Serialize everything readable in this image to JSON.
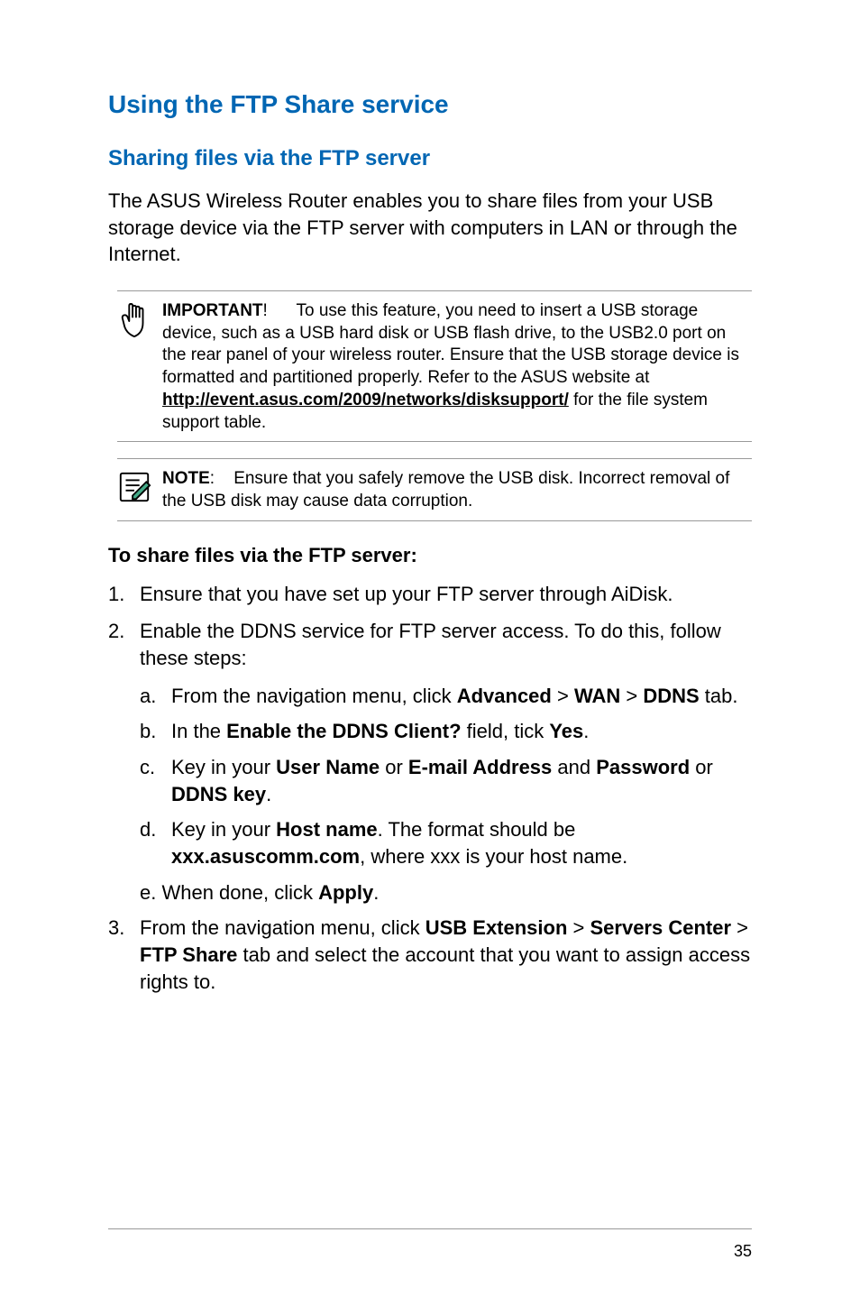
{
  "heading1": "Using the FTP Share service",
  "heading2": "Sharing files via the FTP server",
  "intro": "The ASUS Wireless Router enables you to share files from your USB storage device via the FTP server with computers in LAN or through the Internet.",
  "important": {
    "label": "IMPORTANT",
    "excl": "!",
    "text1": "To use this feature, you need to insert a USB storage device, such as a USB hard disk or USB  flash drive, to the USB2.0 port on the rear panel of your wireless router. Ensure that the USB storage device is formatted and partitioned properly. Refer to the ASUS website at",
    "link": "http://event.asus.com/2009/networks/disksupport/",
    "text2": " for the file system support table."
  },
  "note": {
    "label": "NOTE",
    "colon": ":",
    "text": "Ensure that you safely remove the USB disk. Incorrect removal of the USB disk may cause data corruption."
  },
  "heading3": "To share files via the FTP server:",
  "step1": {
    "num": "1.",
    "text": "Ensure that you have set up your FTP server through AiDisk."
  },
  "step2": {
    "num": "2.",
    "text": "Enable the DDNS service for FTP server access. To do this, follow these steps:",
    "a": {
      "letter": "a.",
      "pre": "From the navigation menu, click ",
      "b1": "Advanced",
      "gt1": " > ",
      "b2": "WAN",
      "gt2": " > ",
      "b3": "DDNS",
      "post": " tab."
    },
    "b": {
      "letter": "b.",
      "pre": "In the ",
      "b1": "Enable the DDNS Client?",
      "mid": " field, tick ",
      "b2": "Yes",
      "post": "."
    },
    "c": {
      "letter": "c.",
      "pre": "Key in your ",
      "b1": "User Name",
      "or1": " or ",
      "b2": "E-mail Address",
      "and1": " and ",
      "b3": "Password",
      "or2": " or ",
      "b4": "DDNS key",
      "post": "."
    },
    "d": {
      "letter": "d.",
      "pre": "Key in your ",
      "b1": "Host name",
      "mid": ". The format should be ",
      "b2": "xxx.asuscomm.com",
      "post": ", where xxx is your host name."
    },
    "e": {
      "pre": "e. When done, click ",
      "b1": "Apply",
      "post": "."
    }
  },
  "step3": {
    "num": "3.",
    "pre": "From the navigation menu, click ",
    "b1": "USB Extension",
    "gt1": " > ",
    "b2": "Servers Center",
    "gt2": " > ",
    "b3": "FTP Share",
    "post": " tab and select the account that you want to assign access rights to."
  },
  "pageNum": "35"
}
